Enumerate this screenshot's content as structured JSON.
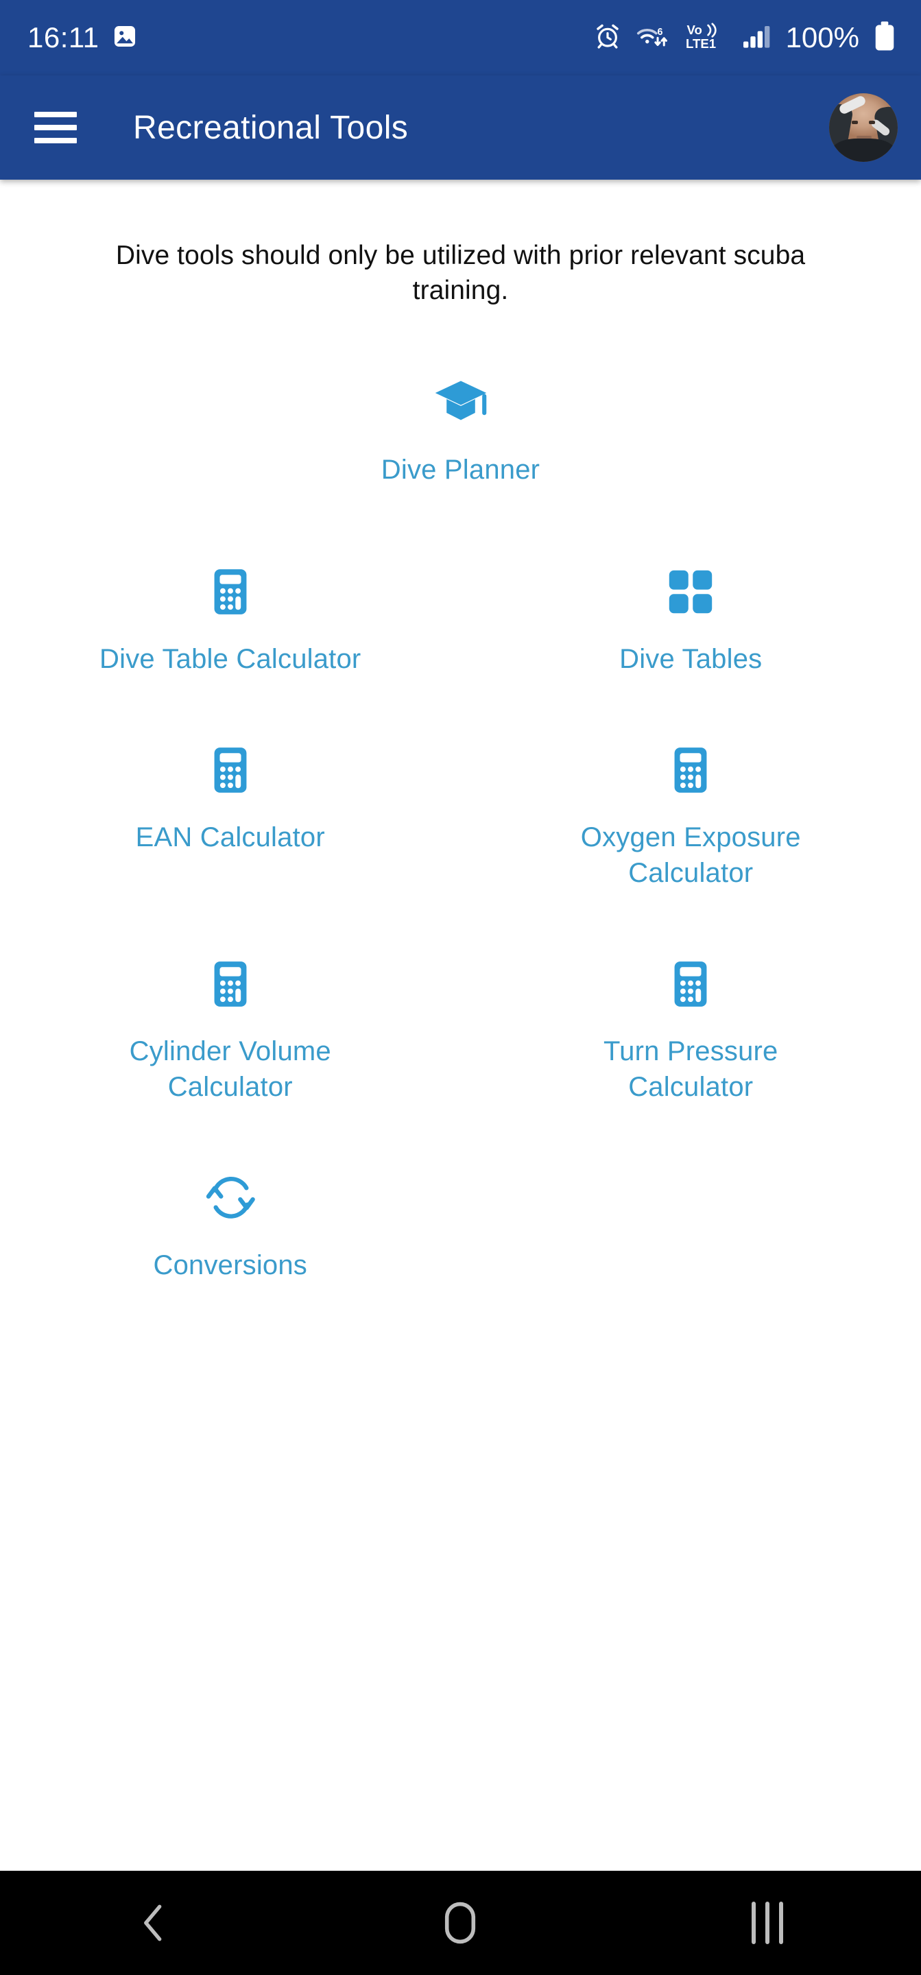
{
  "status_bar": {
    "time": "16:11",
    "battery_percent": "100%",
    "network_label": "LTE1",
    "volte_label": "Vo))",
    "wifi_generation": "6",
    "icons": [
      "screenshot-icon",
      "alarm-icon",
      "wifi-icon",
      "volte-icon",
      "signal-icon",
      "battery-icon"
    ]
  },
  "app_bar": {
    "title": "Recreational Tools",
    "menu_icon": "hamburger-menu-icon",
    "avatar_label": "user-avatar"
  },
  "content": {
    "disclaimer": "Dive tools should only be utilized with prior relevant scuba training.",
    "tiles": [
      {
        "label": "Dive Planner",
        "icon": "graduation-cap-icon"
      },
      {
        "label": "Dive Table Calculator",
        "icon": "calculator-icon"
      },
      {
        "label": "Dive Tables",
        "icon": "grid-four-squares-icon"
      },
      {
        "label": "EAN Calculator",
        "icon": "calculator-icon"
      },
      {
        "label": "Oxygen Exposure Calculator",
        "icon": "calculator-icon"
      },
      {
        "label": "Cylinder Volume Calculator",
        "icon": "calculator-icon"
      },
      {
        "label": "Turn Pressure Calculator",
        "icon": "calculator-icon"
      },
      {
        "label": "Conversions",
        "icon": "sync-arrows-icon"
      }
    ]
  },
  "nav_bar": {
    "back_icon": "back-chevron-icon",
    "home_icon": "home-circle-icon",
    "recents_icon": "recents-bars-icon"
  },
  "colors": {
    "app_bar_blue": "#1F4690",
    "icon_blue": "#2E9BD6",
    "label_blue": "#3A9BCB",
    "page_background": "#FFFFFF",
    "nav_bar_black": "#000000",
    "nav_icon_gray": "#BDBDBD"
  }
}
